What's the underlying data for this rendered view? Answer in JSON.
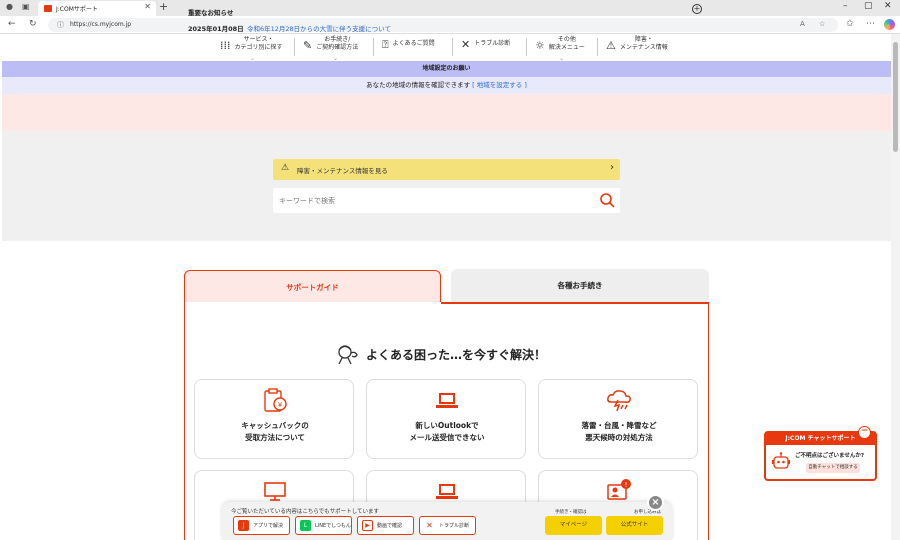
{
  "browser": {
    "tab_title": "J:COMサポート",
    "url": "https://cs.myjcom.jp",
    "new_tab": "+",
    "tab_close": "✕"
  },
  "site_nav": {
    "items": [
      {
        "label": "サービス・\nカテゴリ別に探す",
        "icon": "grid-icon"
      },
      {
        "label": "お手続き/\nご契約確認方法",
        "icon": "edit-icon"
      },
      {
        "label": "よくあるご質問",
        "icon": "question-icon"
      },
      {
        "label": "トラブル診断",
        "icon": "tools-icon"
      },
      {
        "label": "その他\n解決メニュー",
        "icon": "bulb-icon"
      },
      {
        "label": "障害・\nメンテナンス情報",
        "icon": "warning-icon"
      }
    ]
  },
  "region": {
    "title": "地域設定のお願い",
    "message": "あなたの地域の情報を確認できます",
    "link": "[ 地域を設定する ]"
  },
  "notice": {
    "title": "重要なお知らせ",
    "date": "2025年01月08日",
    "link": "令和6年12月28日からの大雪に伴う支援について"
  },
  "search": {
    "maintenance_label": "障害・メンテナンス情報を見る",
    "placeholder": "キーワードで検索"
  },
  "tabs": {
    "guide": "サポートガイド",
    "procedures": "各種お手続き"
  },
  "panel": {
    "title": "よくある困った…を今すぐ解決！",
    "cards": [
      {
        "label": "キャッシュバックの\n受取方法について",
        "icon": "cashback-icon"
      },
      {
        "label": "新しいOutlookで\nメール送受信できない",
        "icon": "laptop-icon"
      },
      {
        "label": "落雷・台風・降雪など\n悪天候時の対処方法",
        "icon": "storm-icon"
      }
    ]
  },
  "floatbar": {
    "text": "今ご覧いただいている内容はこちらでもサポートしています",
    "buttons": [
      {
        "label": "アプリで解決",
        "icon": "jcom-app-icon",
        "color": "#e8380d"
      },
      {
        "label": "LINEでしつもん",
        "icon": "line-icon",
        "color": "#06c755"
      },
      {
        "label": "動画で確認",
        "icon": "video-icon",
        "color": "#e8380d"
      },
      {
        "label": "トラブル診断",
        "icon": "tools-icon",
        "color": "#e8380d"
      }
    ],
    "mypage_small": "手続き・確認は",
    "mypage": "マイページ",
    "official_small": "お申し込みは",
    "official": "公式サイト"
  },
  "chat": {
    "title": "J:COM チャットサポート",
    "question": "ご不明点はございませんか?",
    "button": "自動チャットで相談する"
  },
  "colors": {
    "brand": "#e8380d",
    "region_head": "#bcbdf5",
    "notice_bg": "#fde8e6",
    "maintenance": "#f4e17a"
  }
}
